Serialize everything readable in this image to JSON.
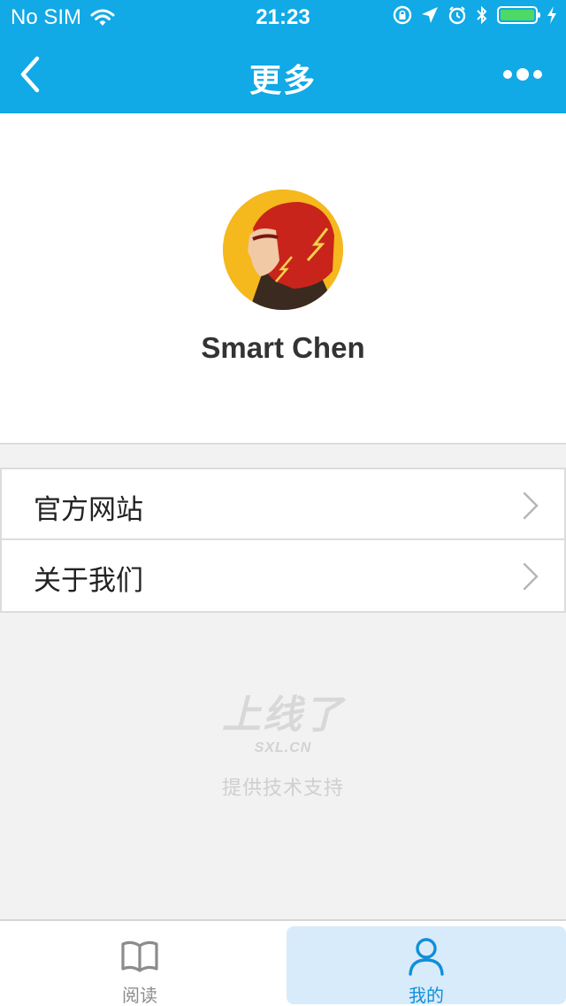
{
  "status_bar": {
    "carrier": "No SIM",
    "time": "21:23",
    "battery_level": 1.0
  },
  "nav": {
    "title": "更多",
    "back_icon": "chevron-left-icon",
    "more_icon": "more-dots-icon"
  },
  "profile": {
    "name": "Smart Chen"
  },
  "menu": [
    {
      "label": "官方网站"
    },
    {
      "label": "关于我们"
    }
  ],
  "branding": {
    "logo": "上线了",
    "domain": "SXL.CN",
    "support_text": "提供技术支持"
  },
  "tabbar": {
    "tabs": [
      {
        "label": "阅读",
        "icon": "book-icon",
        "selected": false
      },
      {
        "label": "我的",
        "icon": "user-icon",
        "selected": true
      }
    ]
  },
  "colors": {
    "primary": "#11a9e6",
    "selected_tab_bg": "#d8ebfb",
    "selected_tab_text": "#0f8fd8"
  }
}
